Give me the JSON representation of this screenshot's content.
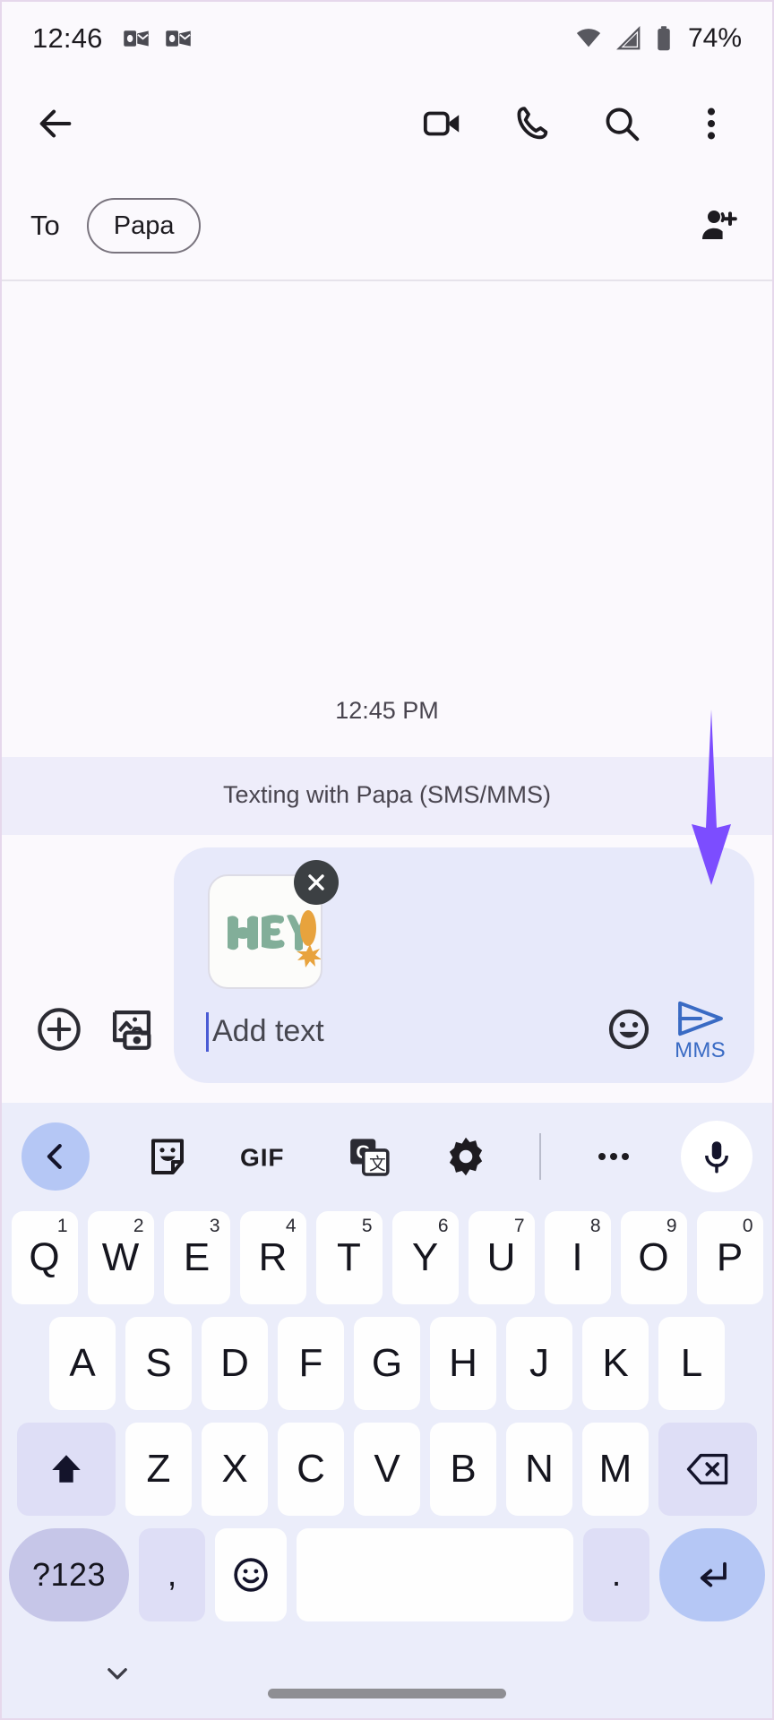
{
  "statusbar": {
    "time": "12:46",
    "battery": "74%",
    "notification_icons": [
      "outlook-notification-icon",
      "outlook-notification-icon"
    ],
    "system_icons": [
      "wifi-icon",
      "cellular-signal-icon",
      "battery-icon"
    ]
  },
  "appbar": {
    "back_label": "back-arrow",
    "actions": [
      {
        "name": "video-call-button",
        "icon": "video-camera-icon"
      },
      {
        "name": "voice-call-button",
        "icon": "phone-icon"
      },
      {
        "name": "search-button",
        "icon": "search-icon"
      },
      {
        "name": "overflow-menu-button",
        "icon": "more-vertical-icon"
      }
    ]
  },
  "recipient": {
    "to_label": "To",
    "chip_name": "Papa",
    "add_person_icon": "add-person-icon"
  },
  "conversation": {
    "timestamp": "12:45 PM",
    "sms_banner": "Texting with Papa (SMS/MMS)"
  },
  "compose": {
    "left_icons": [
      {
        "name": "add-attachment-button",
        "icon": "plus-circle-icon"
      },
      {
        "name": "gallery-camera-button",
        "icon": "image-camera-icon"
      }
    ],
    "attachment": {
      "type": "sticker",
      "alt": "HEY! sticker",
      "sticker_text": "HEY",
      "sticker_color": "#82AE99",
      "accent_color": "#E8A33D",
      "remove_label": "remove-attachment"
    },
    "placeholder": "Add text",
    "emoji_button": "emoji-icon",
    "send_label": "MMS",
    "send_color": "#3A6BC4"
  },
  "annotation": {
    "arrow_color": "#7C4DFF",
    "points_to": "MMS send button"
  },
  "keyboard": {
    "toolbar": [
      {
        "name": "toolbar-back-button",
        "icon": "chevron-left-icon",
        "active": true
      },
      {
        "name": "sticker-button",
        "icon": "sticker-icon"
      },
      {
        "name": "gif-button",
        "icon": "gif-icon",
        "label": "GIF"
      },
      {
        "name": "translate-button",
        "icon": "google-translate-icon"
      },
      {
        "name": "settings-button",
        "icon": "gear-icon"
      },
      {
        "name": "toolbar-divider",
        "icon": "divider"
      },
      {
        "name": "more-options-button",
        "icon": "more-horizontal-icon"
      },
      {
        "name": "voice-input-button",
        "icon": "microphone-icon"
      }
    ],
    "row1": [
      {
        "key": "Q",
        "num": "1"
      },
      {
        "key": "W",
        "num": "2"
      },
      {
        "key": "E",
        "num": "3"
      },
      {
        "key": "R",
        "num": "4"
      },
      {
        "key": "T",
        "num": "5"
      },
      {
        "key": "Y",
        "num": "6"
      },
      {
        "key": "U",
        "num": "7"
      },
      {
        "key": "I",
        "num": "8"
      },
      {
        "key": "O",
        "num": "9"
      },
      {
        "key": "P",
        "num": "0"
      }
    ],
    "row2": [
      "A",
      "S",
      "D",
      "F",
      "G",
      "H",
      "J",
      "K",
      "L"
    ],
    "row3_letters": [
      "Z",
      "X",
      "C",
      "V",
      "B",
      "N",
      "M"
    ],
    "shift_label": "shift-key",
    "backspace_label": "backspace-key",
    "row4": {
      "symbols_label": "?123",
      "comma_label": ",",
      "emoji_label": "emoji-key",
      "space_label": "",
      "period_label": ".",
      "enter_label": "enter-key"
    },
    "hide_keyboard_icon": "chevron-down-icon"
  }
}
